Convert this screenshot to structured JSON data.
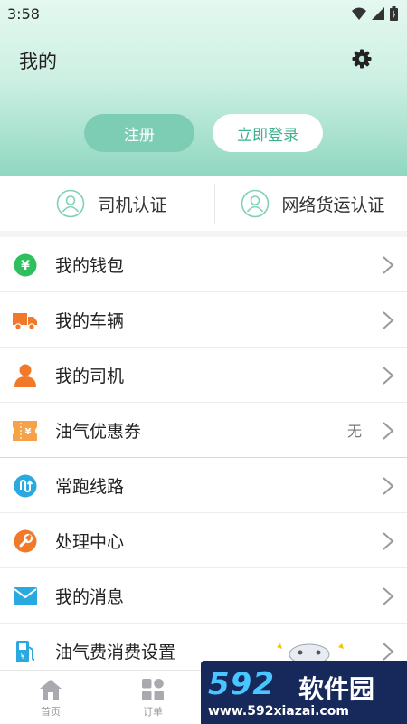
{
  "status_bar": {
    "time": "3:58"
  },
  "header": {
    "title": "我的"
  },
  "auth": {
    "register_label": "注册",
    "login_label": "立即登录"
  },
  "certifications": [
    {
      "label": "司机认证",
      "icon": "person-circle-icon"
    },
    {
      "label": "网络货运认证",
      "icon": "person-circle-icon"
    }
  ],
  "menu": {
    "items": [
      {
        "label": "我的钱包",
        "icon": "yuan-coin-icon",
        "value": ""
      },
      {
        "label": "我的车辆",
        "icon": "truck-icon",
        "value": ""
      },
      {
        "label": "我的司机",
        "icon": "person-icon",
        "value": ""
      },
      {
        "label": "油气优惠券",
        "icon": "coupon-icon",
        "value": "无"
      },
      {
        "label": "常跑线路",
        "icon": "route-icon",
        "value": ""
      },
      {
        "label": "处理中心",
        "icon": "wrench-icon",
        "value": ""
      },
      {
        "label": "我的消息",
        "icon": "mail-icon",
        "value": ""
      },
      {
        "label": "油气费消费设置",
        "icon": "fuel-pump-icon",
        "value": ""
      }
    ]
  },
  "tabbar": {
    "tabs": [
      {
        "label": "首页"
      },
      {
        "label": "订单"
      }
    ]
  },
  "watermark": {
    "brand": "592",
    "name": "软件园",
    "url": "www.592xiazai.com"
  },
  "colors": {
    "accent": "#3fb08e",
    "header_bottom": "#8fd7c0",
    "register_bg": "#7dcdb4"
  }
}
